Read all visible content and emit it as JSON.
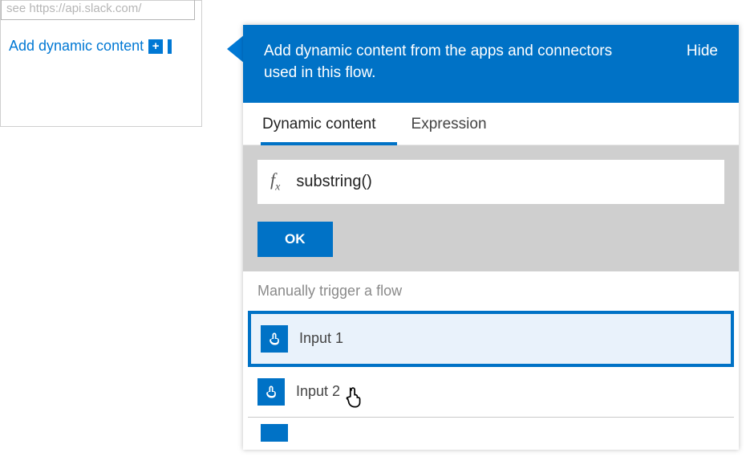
{
  "left": {
    "url_placeholder": "see https://api.slack.com/",
    "add_dynamic_label": "Add dynamic content"
  },
  "panel": {
    "header_text": "Add dynamic content from the apps and connectors used in this flow.",
    "hide_label": "Hide",
    "tabs": {
      "dynamic": "Dynamic content",
      "expression": "Expression"
    },
    "fx_label": "f",
    "fx_sub": "x",
    "expression_text": "substring()",
    "ok_label": "OK",
    "section_label": "Manually trigger a flow",
    "items": [
      {
        "label": "Input 1"
      },
      {
        "label": "Input 2"
      }
    ]
  }
}
